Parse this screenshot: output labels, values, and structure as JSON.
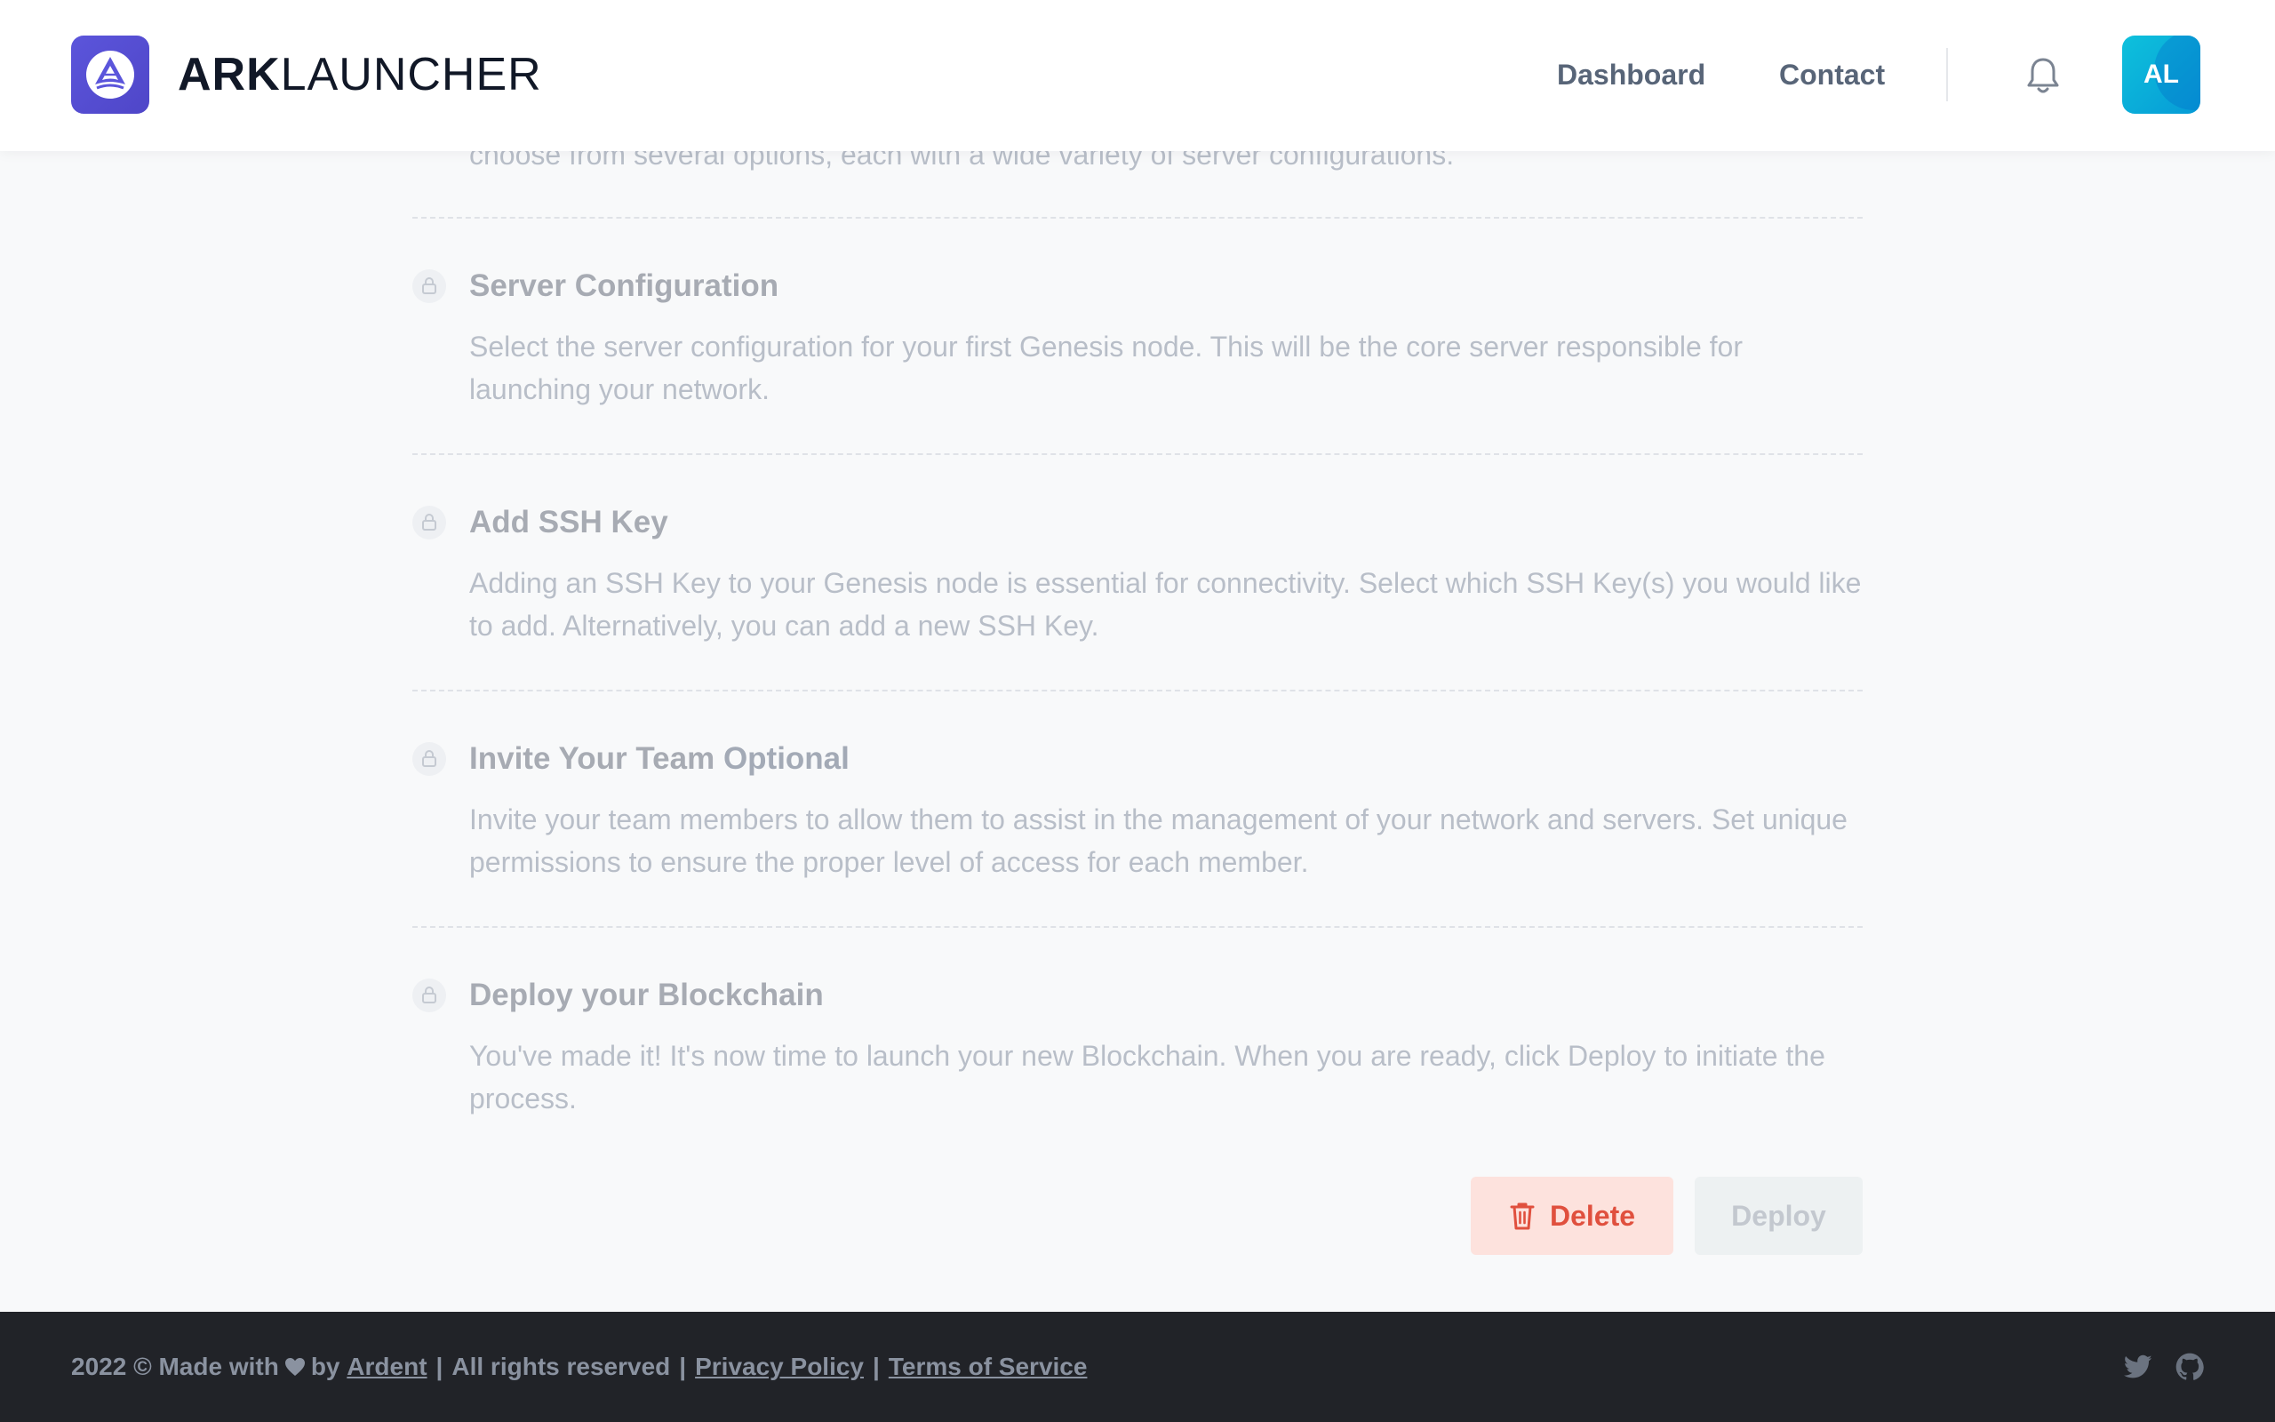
{
  "header": {
    "brand_bold": "ARK",
    "brand_light": "LAUNCHER",
    "nav": {
      "dashboard": "Dashboard",
      "contact": "Contact"
    },
    "avatar_initials": "AL",
    "icons": {
      "logo": "ark-logo-icon",
      "bell": "bell-icon"
    },
    "colors": {
      "logo_bg": "#5b55db",
      "avatar_bg": "#0ec1dc"
    }
  },
  "steps": [
    {
      "title": "",
      "desc": "choose from several options, each with a wide variety of server configurations."
    },
    {
      "title": "Server Configuration",
      "desc": "Select the server configuration for your first Genesis node. This will be the core server responsible for launching your network."
    },
    {
      "title": "Add SSH Key",
      "desc": "Adding an SSH Key to your Genesis node is essential for connectivity. Select which SSH Key(s) you would like to add. Alternatively, you can add a new SSH Key."
    },
    {
      "title": "Invite Your Team",
      "optional": "Optional",
      "desc": "Invite your team members to allow them to assist in the management of your network and servers. Set unique permissions to ensure the proper level of access for each member."
    },
    {
      "title": "Deploy your Blockchain",
      "desc": "You've made it! It's now time to launch your new Blockchain. When you are ready, click Deploy to initiate the process."
    }
  ],
  "actions": {
    "delete_label": "Delete",
    "deploy_label": "Deploy",
    "delete_color": "#e0503e"
  },
  "footer": {
    "made_with": "2022 © Made with",
    "by": "by",
    "author": "Ardent",
    "rights": "All rights reserved",
    "privacy": "Privacy Policy",
    "terms": "Terms of Service",
    "sep": "|",
    "icons": {
      "twitter": "twitter-icon",
      "github": "github-icon"
    }
  }
}
